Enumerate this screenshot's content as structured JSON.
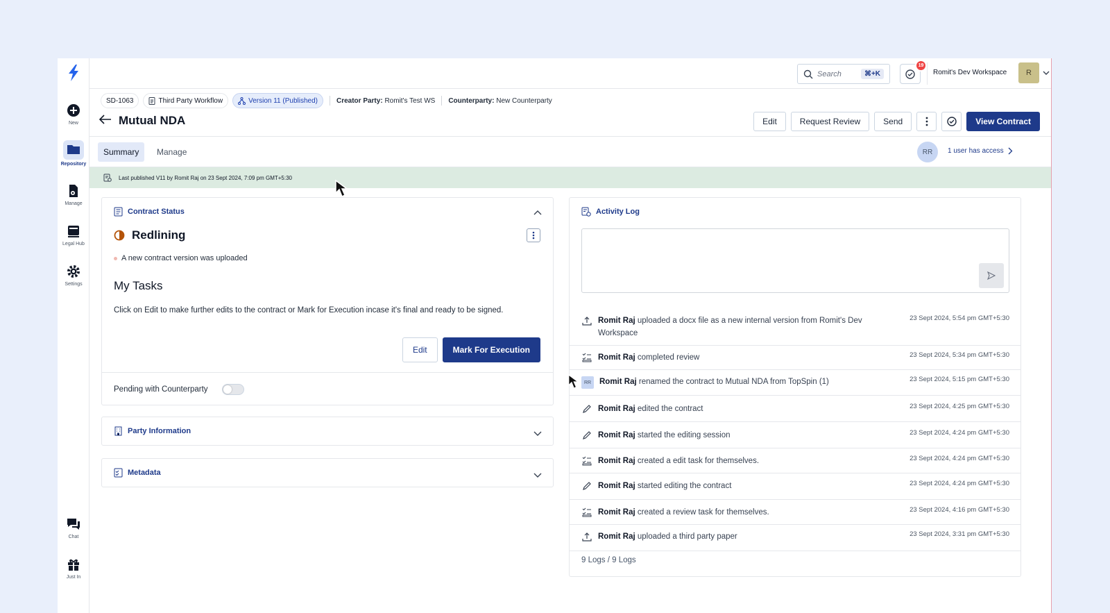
{
  "rail": {
    "items": [
      {
        "label": "New",
        "icon": "plus-circle-icon"
      },
      {
        "label": "Repository",
        "icon": "folder-icon"
      },
      {
        "label": "Manage",
        "icon": "document-gear-icon"
      },
      {
        "label": "Legal Hub",
        "icon": "legal-hub-icon"
      },
      {
        "label": "Settings",
        "icon": "gear-icon"
      },
      {
        "label": "Chat",
        "icon": "chat-icon"
      },
      {
        "label": "Just In",
        "icon": "gift-icon"
      }
    ]
  },
  "topbar": {
    "search_placeholder": "Search",
    "search_shortcut": "⌘+K",
    "notification_count": "19",
    "workspace_name": "Romit's Dev Workspace",
    "workspace_avatar": "R"
  },
  "header": {
    "id_chip": "SD-1063",
    "workflow_chip": "Third Party Workflow",
    "version_chip": "Version 11 (Published)",
    "creator_label": "Creator Party:",
    "creator_value": "Romit's Test WS",
    "counterparty_label": "Counterparty:",
    "counterparty_value": "New Counterparty",
    "title": "Mutual NDA",
    "actions": {
      "edit": "Edit",
      "request_review": "Request Review",
      "send": "Send",
      "view_contract": "View Contract"
    }
  },
  "tabs": {
    "summary": "Summary",
    "manage": "Manage",
    "access_avatar": "RR",
    "access_text": "1 user has access"
  },
  "banner": {
    "text": "Last published V11 by Romit Raj on 23 Sept 2024, 7:09 pm GMT+5:30"
  },
  "status_card": {
    "title": "Contract Status",
    "status": "Redlining",
    "bullet": "A new contract version was uploaded",
    "tasks_title": "My Tasks",
    "tasks_desc": "Click on Edit to make further edits to the contract or Mark for Execution incase it's final and ready to be signed.",
    "edit_button": "Edit",
    "mark_button": "Mark For Execution",
    "pending_label": "Pending with Counterparty"
  },
  "party_card": {
    "title": "Party Information"
  },
  "metadata_card": {
    "title": "Metadata"
  },
  "activity": {
    "title": "Activity Log",
    "logs": [
      {
        "icon": "upload-icon",
        "user": "Romit Raj",
        "text": "uploaded a docx file as a new internal version from Romit's Dev Workspace",
        "time": "23 Sept 2024, 5:54 pm GMT+5:30"
      },
      {
        "icon": "task-icon",
        "user": "Romit Raj",
        "text": "completed review",
        "time": "23 Sept 2024, 5:34 pm GMT+5:30"
      },
      {
        "icon": "avatar-rr",
        "user": "Romit Raj",
        "text": "renamed the contract to Mutual NDA from TopSpin (1)",
        "time": "23 Sept 2024, 5:15 pm GMT+5:30"
      },
      {
        "icon": "pencil-icon",
        "user": "Romit Raj",
        "text": "edited the contract",
        "time": "23 Sept 2024, 4:25 pm GMT+5:30"
      },
      {
        "icon": "pencil-icon",
        "user": "Romit Raj",
        "text": "started the editing session",
        "time": "23 Sept 2024, 4:24 pm GMT+5:30"
      },
      {
        "icon": "task-icon",
        "user": "Romit Raj",
        "text": "created a edit task for themselves.",
        "time": "23 Sept 2024, 4:24 pm GMT+5:30"
      },
      {
        "icon": "pencil-icon",
        "user": "Romit Raj",
        "text": "started editing the contract",
        "time": "23 Sept 2024, 4:24 pm GMT+5:30"
      },
      {
        "icon": "task-icon",
        "user": "Romit Raj",
        "text": "created a review task for themselves.",
        "time": "23 Sept 2024, 4:16 pm GMT+5:30"
      },
      {
        "icon": "upload-icon",
        "user": "Romit Raj",
        "text": "uploaded a third party paper",
        "time": "23 Sept 2024, 3:31 pm GMT+5:30"
      }
    ],
    "footer": "9 Logs / 9 Logs",
    "rr_avatar": "RR"
  },
  "colors": {
    "brand": "#1e3a8a",
    "banner": "#dcebe1",
    "notification": "#ef4444",
    "status_icon": "#b45309"
  }
}
